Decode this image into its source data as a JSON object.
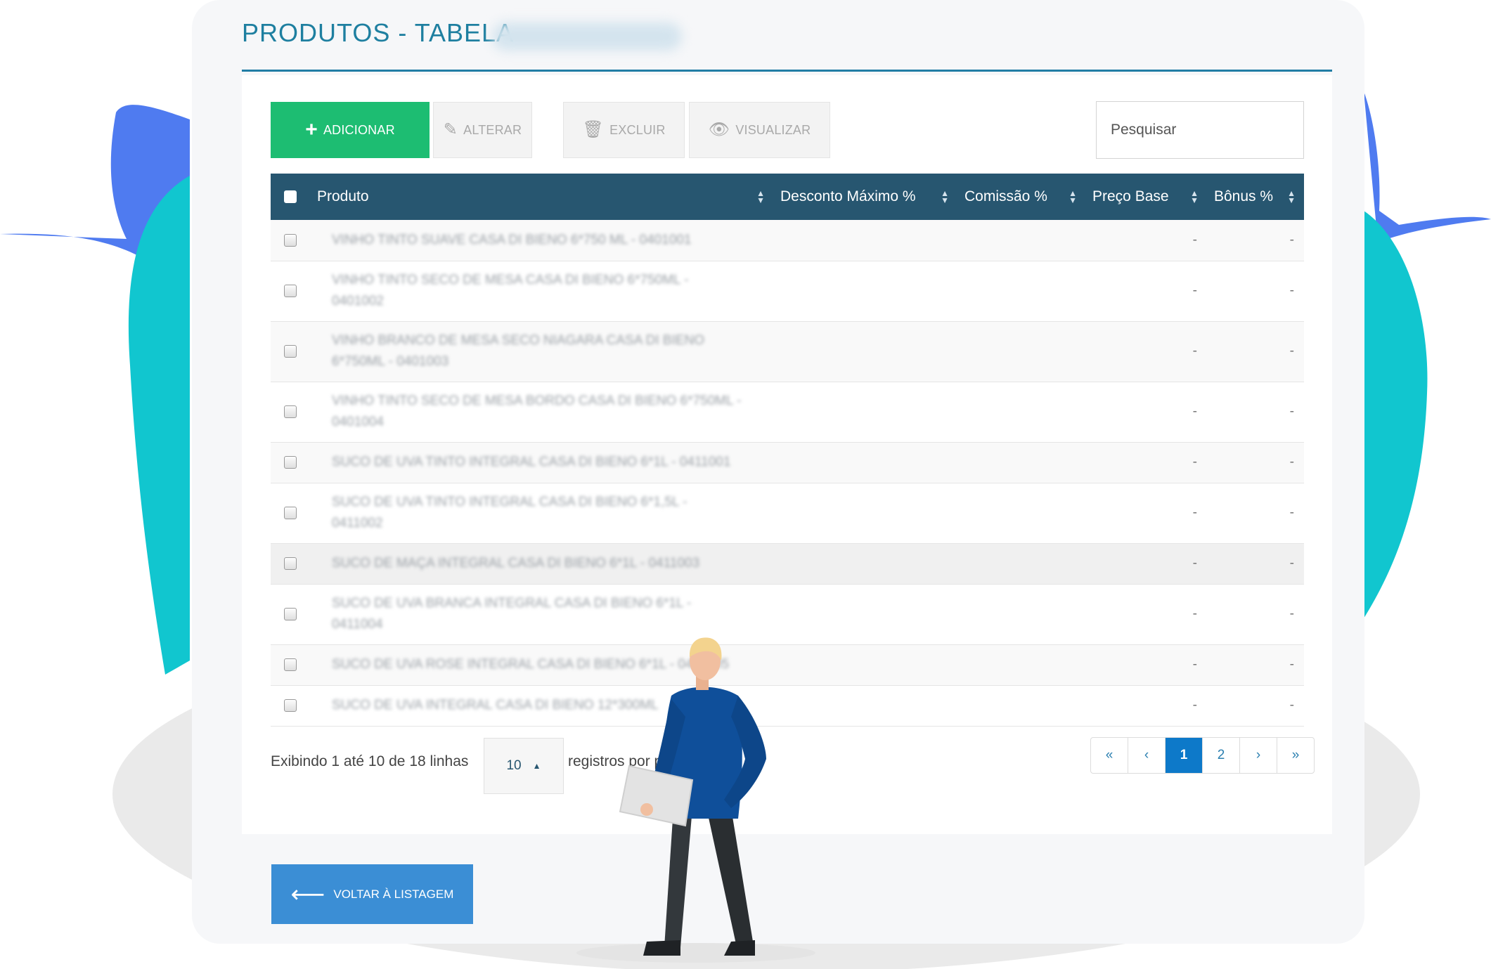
{
  "page": {
    "title": "PRODUTOS - TABELA"
  },
  "toolbar": {
    "add_icon": "plus-icon",
    "add_label": "ADICIONAR",
    "alter_icon": "pencil-icon",
    "alter_label": "ALTERAR",
    "delete_icon": "trash-icon",
    "delete_label": "EXCLUIR",
    "view_icon": "eye-icon",
    "view_label": "VISUALIZAR",
    "search_placeholder": "Pesquisar"
  },
  "table": {
    "columns": [
      "Produto",
      "Desconto Máximo %",
      "Comissão %",
      "Preço Base",
      "Bônus %"
    ],
    "rows": [
      {
        "product": "VINHO TINTO SUAVE CASA DI BIENO 6*750 ML - 0401001",
        "preco_base": "-",
        "bonus": "-"
      },
      {
        "product": "VINHO TINTO SECO DE MESA CASA DI BIENO 6*750ML - 0401002",
        "preco_base": "-",
        "bonus": "-"
      },
      {
        "product": "VINHO BRANCO DE MESA SECO NIAGARA CASA DI BIENO 6*750ML - 0401003",
        "preco_base": "-",
        "bonus": "-"
      },
      {
        "product": "VINHO TINTO SECO DE MESA BORDO CASA DI BIENO 6*750ML - 0401004",
        "preco_base": "-",
        "bonus": "-"
      },
      {
        "product": "SUCO DE UVA TINTO INTEGRAL CASA DI BIENO 6*1L - 0411001",
        "preco_base": "-",
        "bonus": "-"
      },
      {
        "product": "SUCO DE UVA TINTO INTEGRAL CASA DI BIENO 6*1,5L - 0411002",
        "preco_base": "-",
        "bonus": "-"
      },
      {
        "product": "SUCO DE MAÇA INTEGRAL CASA DI BIENO 6*1L - 0411003",
        "preco_base": "-",
        "bonus": "-"
      },
      {
        "product": "SUCO DE UVA BRANCA INTEGRAL CASA DI BIENO 6*1L - 0411004",
        "preco_base": "-",
        "bonus": "-"
      },
      {
        "product": "SUCO DE UVA ROSE INTEGRAL CASA DI BIENO 6*1L - 0411005",
        "preco_base": "-",
        "bonus": "-"
      },
      {
        "product": "SUCO DE UVA INTEGRAL CASA DI BIENO 12*300ML",
        "preco_base": "-",
        "bonus": "-"
      }
    ]
  },
  "footer": {
    "info_prefix": "Exibindo 1 até 10 de 18 linhas",
    "page_size": "10",
    "info_suffix": "registros por página",
    "pager": [
      "«",
      "‹",
      "1",
      "2",
      "›",
      "»"
    ],
    "active_page": "1"
  },
  "back_button": {
    "icon": "arrow-left-icon",
    "label": "VOLTAR À LISTAGEM"
  },
  "colors": {
    "title": "#1e7fa0",
    "header_bg": "#275670",
    "add_button": "#1dbd72",
    "back_button": "#3b8ed5",
    "pager_active": "#0d79c9"
  }
}
